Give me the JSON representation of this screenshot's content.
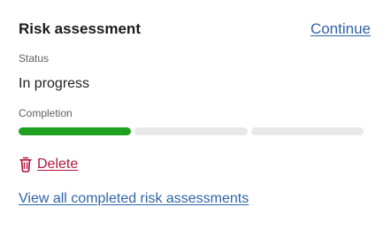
{
  "card": {
    "title": "Risk assessment",
    "continue_label": "Continue",
    "status_label": "Status",
    "status_value": "In progress",
    "completion_label": "Completion",
    "completion": {
      "segments_total": 3,
      "segments_complete": 1,
      "complete_color": "#1fa11f",
      "incomplete_color": "#e8e8e8"
    },
    "delete_label": "Delete",
    "delete_icon": "trash-icon",
    "view_all_label": "View all completed risk assessments"
  },
  "colors": {
    "link": "#2f64a6",
    "danger": "#b2163c",
    "heading": "#1b1b1b",
    "muted": "#5f5f5f"
  }
}
